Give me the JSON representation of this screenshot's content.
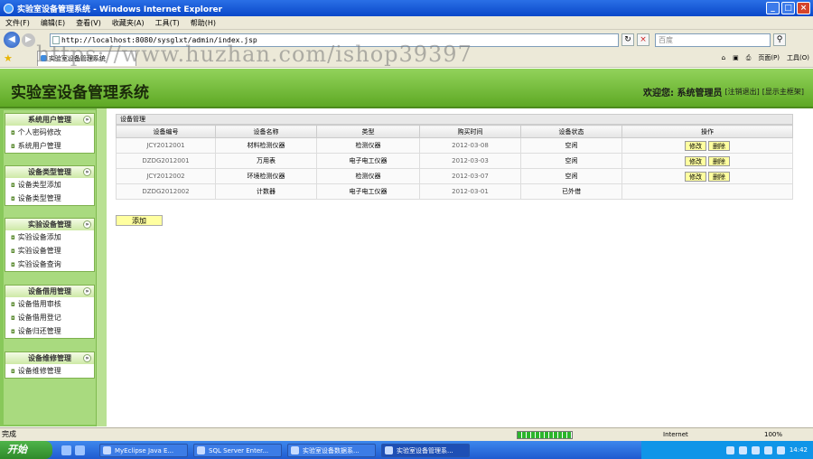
{
  "window": {
    "title": "实验室设备管理系统 - Windows Internet Explorer"
  },
  "menu": [
    "文件(F)",
    "编辑(E)",
    "查看(V)",
    "收藏夹(A)",
    "工具(T)",
    "帮助(H)"
  ],
  "address": {
    "url": "http://localhost:8080/sysglxt/admin/index.jsp"
  },
  "search": {
    "placeholder": "百度"
  },
  "tab": {
    "label": "实验室设备管理系统"
  },
  "watermark": "https://www.huzhan.com/ishop39397",
  "commandbar": {
    "page": "页面(P)",
    "tools": "工具(O)"
  },
  "header": {
    "title": "实验室设备管理系统",
    "welcome": "欢迎您: 系统管理员",
    "logout": "[注销退出]",
    "home": "[显示主框架]"
  },
  "sidebar": [
    {
      "title": "系统用户管理",
      "items": [
        "个人密码修改",
        "系统用户管理"
      ]
    },
    {
      "title": "设备类型管理",
      "items": [
        "设备类型添加",
        "设备类型管理"
      ]
    },
    {
      "title": "实验设备管理",
      "items": [
        "实验设备添加",
        "实验设备管理",
        "实验设备查询"
      ]
    },
    {
      "title": "设备借用管理",
      "items": [
        "设备借用审核",
        "设备借用登记",
        "设备归还管理"
      ]
    },
    {
      "title": "设备维修管理",
      "items": [
        "设备维修管理"
      ]
    }
  ],
  "panel": {
    "title": "设备管理",
    "columns": [
      "设备编号",
      "设备名称",
      "类型",
      "购买时间",
      "设备状态",
      "操作"
    ],
    "rows": [
      {
        "id": "JCY2012001",
        "name": "材料检测仪器",
        "type": "检测仪器",
        "date": "2012-03-08",
        "status": "空闲",
        "ops": [
          "修改",
          "删除"
        ]
      },
      {
        "id": "DZDG2012001",
        "name": "万用表",
        "type": "电子电工仪器",
        "date": "2012-03-03",
        "status": "空闲",
        "ops": [
          "修改",
          "删除"
        ]
      },
      {
        "id": "JCY2012002",
        "name": "环境检测仪器",
        "type": "检测仪器",
        "date": "2012-03-07",
        "status": "空闲",
        "ops": [
          "修改",
          "删除"
        ]
      },
      {
        "id": "DZDG2012002",
        "name": "计数器",
        "type": "电子电工仪器",
        "date": "2012-03-01",
        "status": "已外借",
        "ops": []
      }
    ],
    "add_label": "添加"
  },
  "status": {
    "text": "完成",
    "zone": "Internet",
    "zoom": "100%"
  },
  "taskbar": {
    "start": "开始",
    "buttons": [
      "MyEclipse Java E...",
      "SQL Server Enter...",
      "实验室设备数据系...",
      "实验室设备管理系..."
    ],
    "clock": "14:42"
  }
}
